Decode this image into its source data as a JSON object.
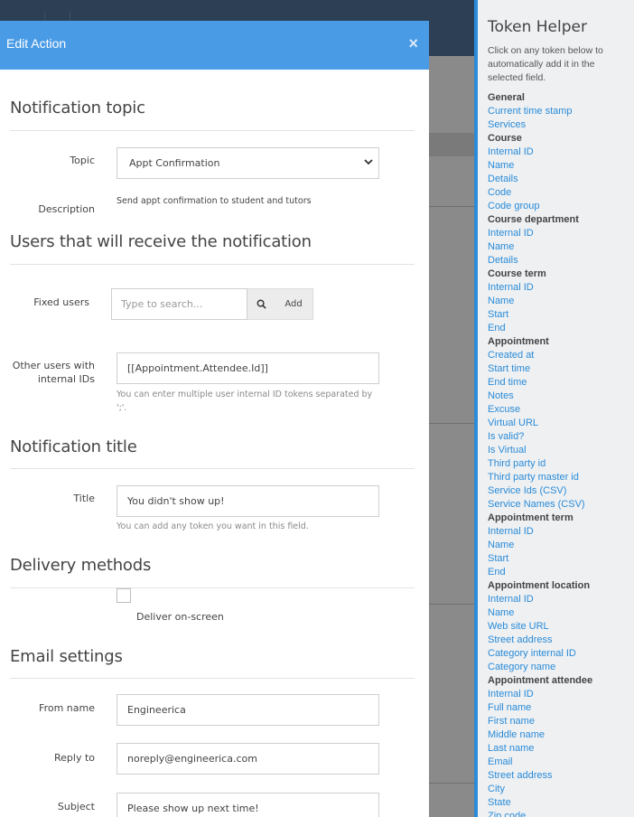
{
  "modal": {
    "title": "Edit Action",
    "close_glyph": "×"
  },
  "sections": {
    "notification_topic": "Notification topic",
    "users": "Users that will receive the notification",
    "notification_title": "Notification title",
    "delivery_methods": "Delivery methods",
    "email_settings": "Email settings"
  },
  "topic": {
    "label": "Topic",
    "value": "Appt Confirmation",
    "description_label": "Description",
    "description": "Send appt confirmation to student and tutors"
  },
  "fixed_users": {
    "label": "Fixed users",
    "placeholder": "Type to search...",
    "search_icon": "search-icon",
    "add_label": "Add"
  },
  "other_users": {
    "label_line1": "Other users with",
    "label_line2": "internal IDs",
    "value": "[[Appointment.Attendee.Id]]",
    "help_line1": "You can enter multiple user internal ID tokens separated by",
    "help_line2": "';'."
  },
  "title_field": {
    "label": "Title",
    "value": "You didn't show up!",
    "help": "You can add any token you want in this field."
  },
  "delivery": {
    "on_screen_label": "Deliver on-screen",
    "on_screen_checked": false
  },
  "email": {
    "from_name_label": "From name",
    "from_name": "Engineerica",
    "reply_to_label": "Reply to",
    "reply_to": "noreply@engineerica.com",
    "subject_label": "Subject",
    "subject": "Please show up next time!"
  },
  "helper": {
    "title": "Token Helper",
    "intro": "Click on any token below to automatically add it in the selected field.",
    "groups": [
      {
        "name": "General",
        "tokens": [
          "Current time stamp",
          "Services"
        ]
      },
      {
        "name": "Course",
        "tokens": [
          "Internal ID",
          "Name",
          "Details",
          "Code",
          "Code group"
        ]
      },
      {
        "name": "Course department",
        "tokens": [
          "Internal ID",
          "Name",
          "Details"
        ]
      },
      {
        "name": "Course term",
        "tokens": [
          "Internal ID",
          "Name",
          "Start",
          "End"
        ]
      },
      {
        "name": "Appointment",
        "tokens": [
          "Created at",
          "Start time",
          "End time",
          "Notes",
          "Excuse",
          "Virtual URL",
          "Is valid?",
          "Is Virtual",
          "Third party id",
          "Third party master id",
          "Service Ids (CSV)",
          "Service Names (CSV)"
        ]
      },
      {
        "name": "Appointment term",
        "tokens": [
          "Internal ID",
          "Name",
          "Start",
          "End"
        ]
      },
      {
        "name": "Appointment location",
        "tokens": [
          "Internal ID",
          "Name",
          "Web site URL",
          "Street address",
          "Category internal ID",
          "Category name"
        ]
      },
      {
        "name": "Appointment attendee",
        "tokens": [
          "Internal ID",
          "Full name",
          "First name",
          "Middle name",
          "Last name",
          "Email",
          "Street address",
          "City",
          "State",
          "Zip code"
        ]
      }
    ]
  },
  "colors": {
    "header_blue": "#4a9be6",
    "link_blue": "#2a8bd8",
    "helper_bg": "#eef0f2"
  }
}
